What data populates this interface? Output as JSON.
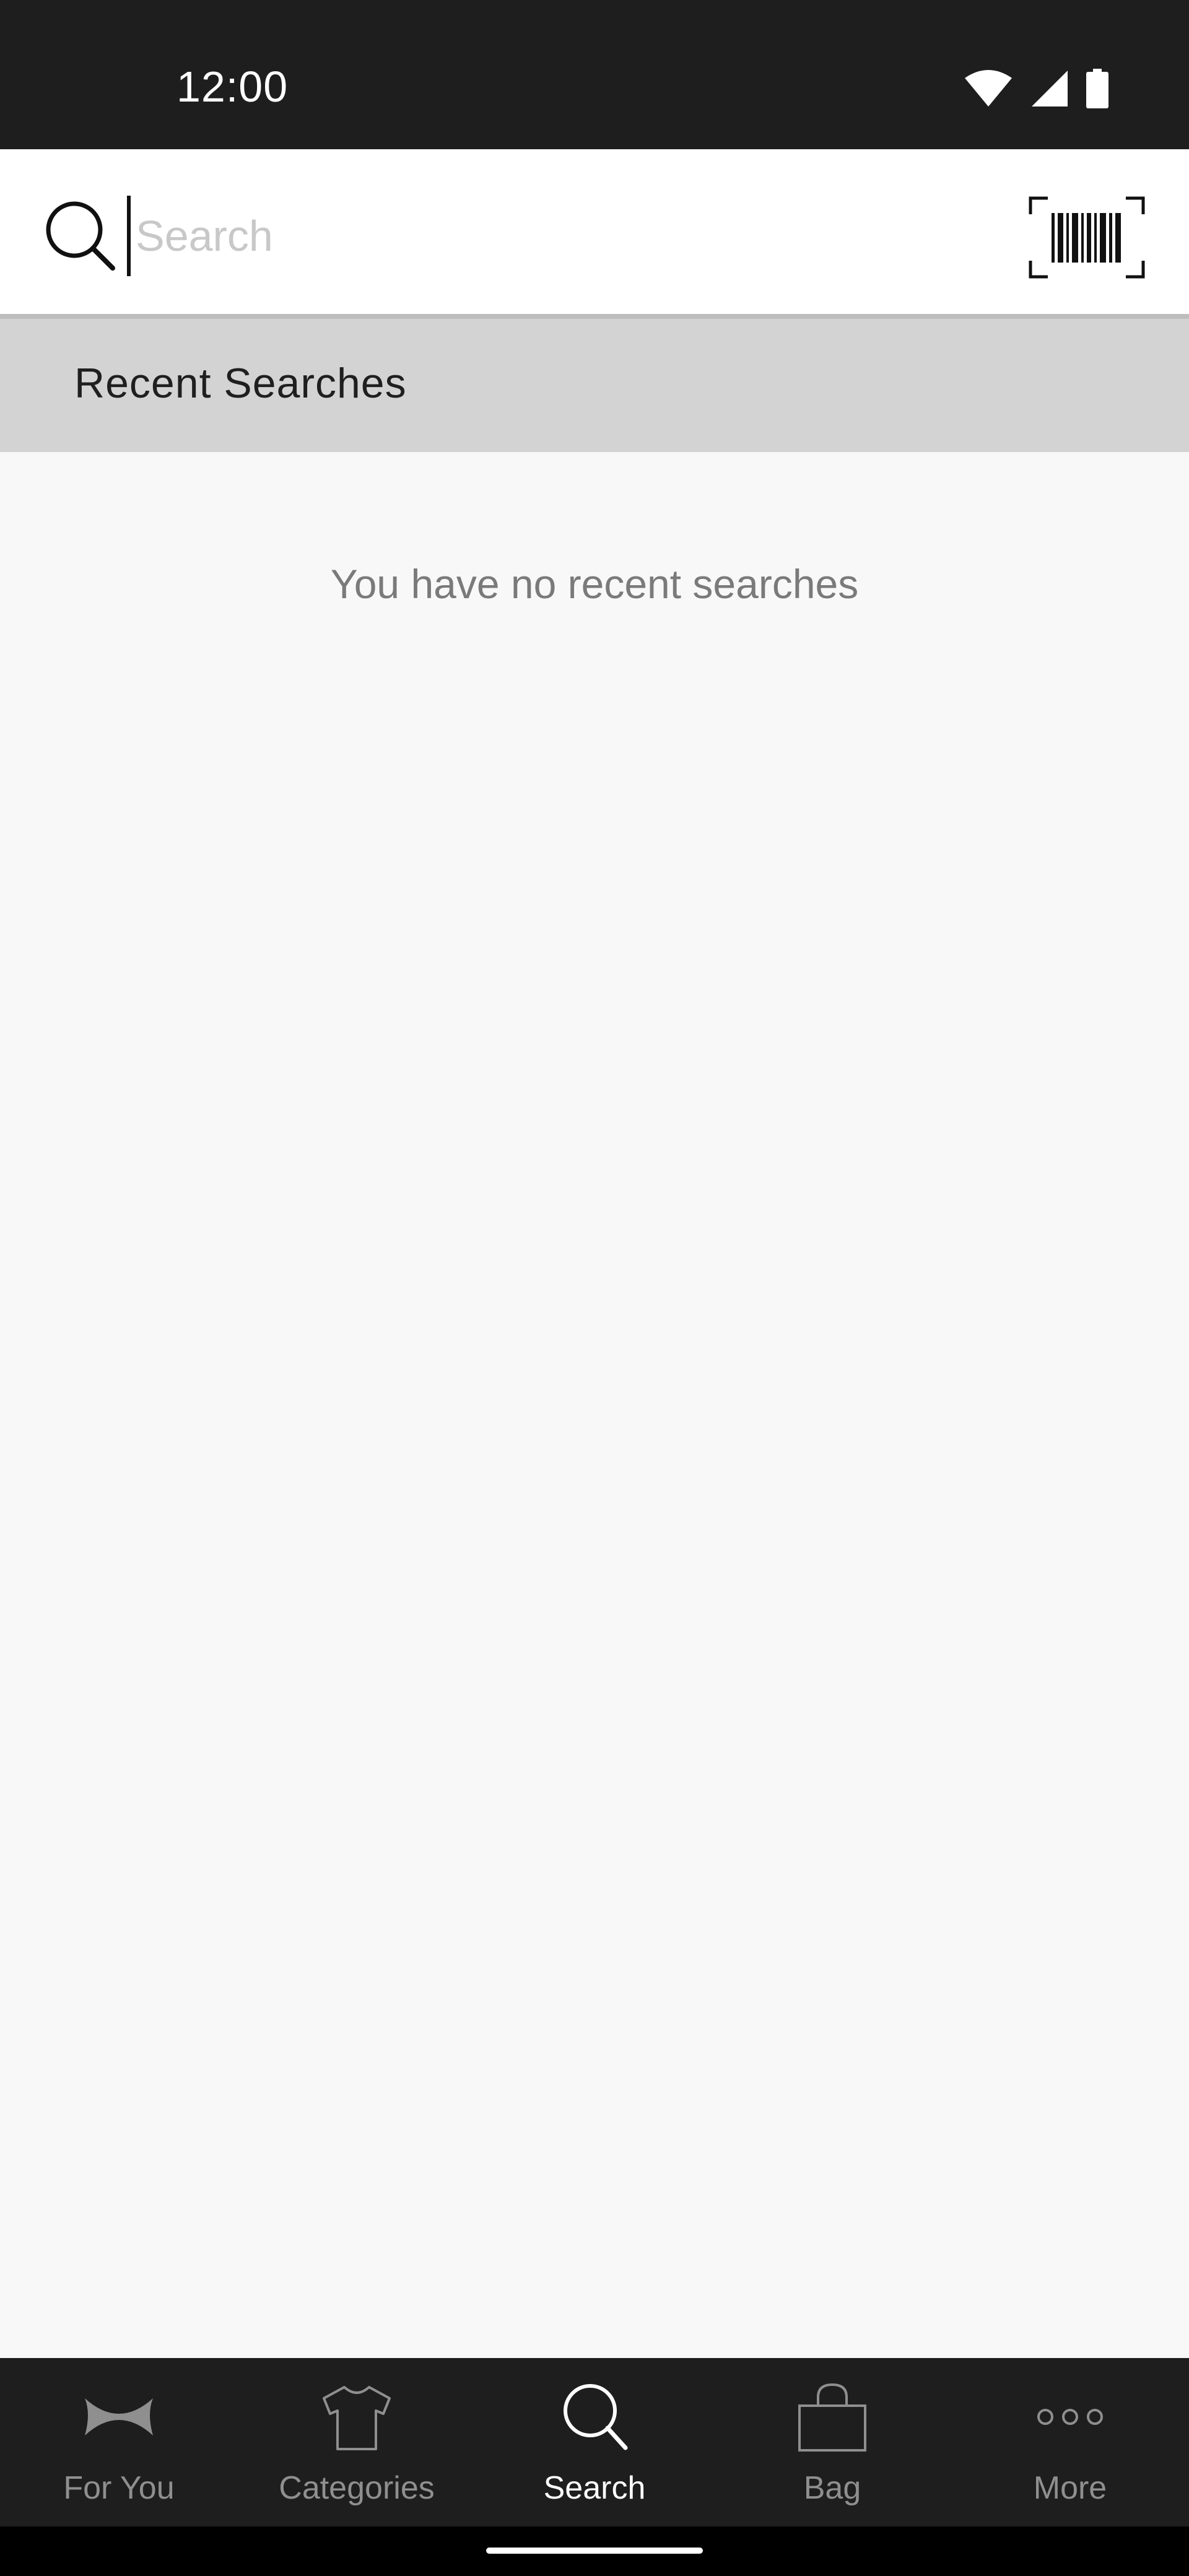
{
  "status_bar": {
    "time": "12:00",
    "icons": [
      "wifi-icon",
      "cellular-signal-icon",
      "battery-icon"
    ]
  },
  "search": {
    "placeholder": "Search",
    "value": "",
    "barcode_icon": "barcode-scan-icon"
  },
  "recent": {
    "title": "Recent Searches",
    "empty_message": "You have no recent searches"
  },
  "bottom_nav": {
    "items": [
      {
        "label": "For You",
        "icon": "brand-logo-icon",
        "active": false
      },
      {
        "label": "Categories",
        "icon": "shirt-icon",
        "active": false
      },
      {
        "label": "Search",
        "icon": "search-icon",
        "active": true
      },
      {
        "label": "Bag",
        "icon": "bag-icon",
        "active": false
      },
      {
        "label": "More",
        "icon": "more-dots-icon",
        "active": false
      }
    ]
  },
  "colors": {
    "status_bar_bg": "#1e1e1e",
    "header_bg": "#d3d3d3",
    "page_bg": "#f8f8f8",
    "nav_active": "#ffffff",
    "nav_inactive": "#8f8f8f"
  }
}
